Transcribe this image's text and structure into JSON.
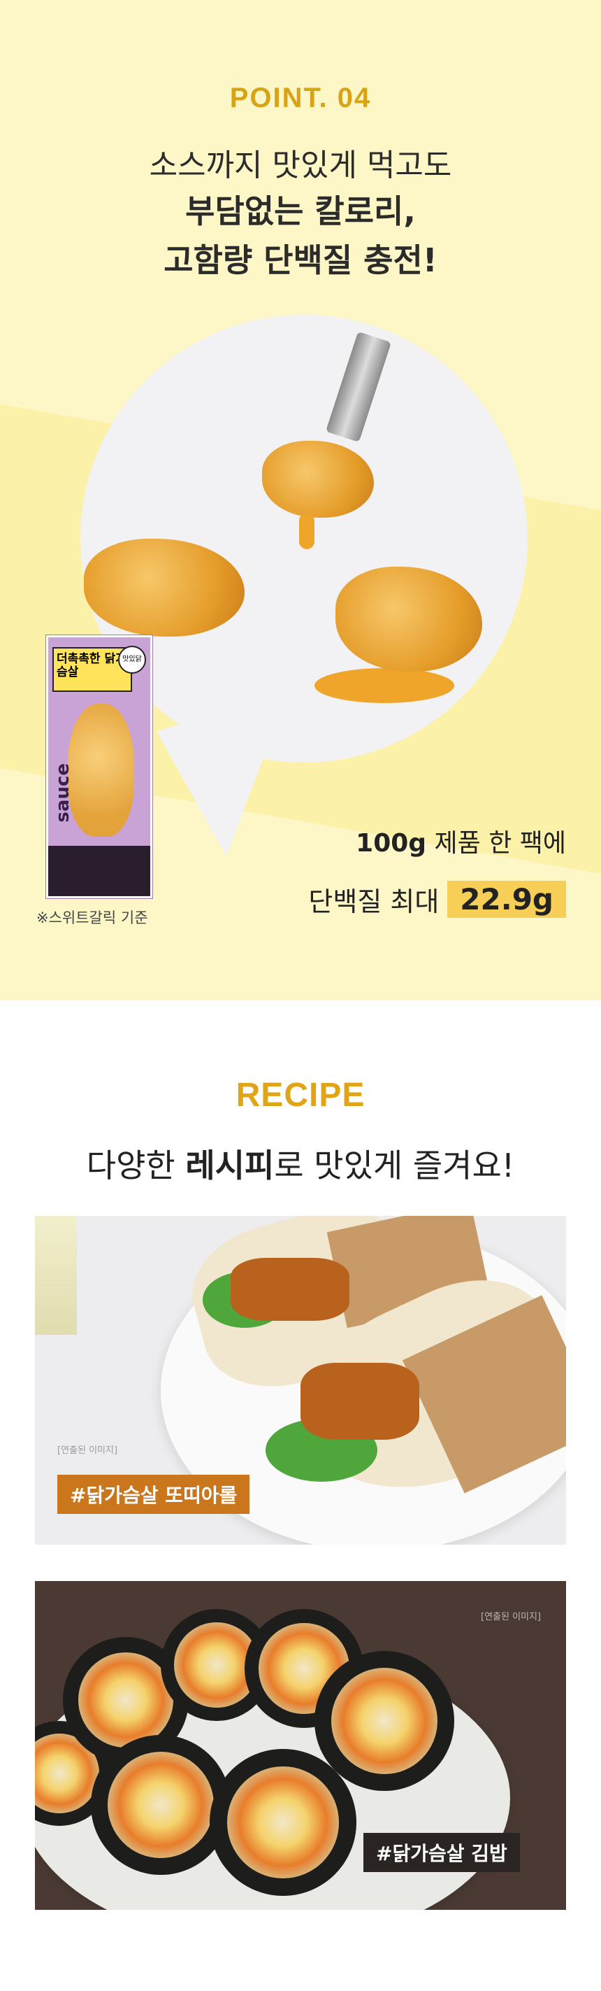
{
  "point": {
    "label": "POINT. 04",
    "line1": "소스까지 맛있게 먹고도",
    "line2": "부담없는 칼로리,",
    "line3": "고함량 단백질 충전!"
  },
  "product": {
    "pack_badge": "맛있닭",
    "pack_brand": "더촉촉한 닭가슴살",
    "pack_sauce": "sauce",
    "base_note": "※스위트갈릭 기준",
    "serving_prefix": "100g",
    "serving_suffix": " 제품 한 팩에",
    "protein_label": "단백질 최대",
    "protein_value": "22.9g"
  },
  "recipe": {
    "label": "RECIPE",
    "headline_pre": "다양한 ",
    "headline_bold": "레시피",
    "headline_post": "로 맛있게 즐겨요!",
    "items": [
      {
        "tag": "#닭가슴살 또띠아롤",
        "note": "[연출된 이미지]"
      },
      {
        "tag": "#닭가슴살 김밥",
        "note": "[연출된 이미지]"
      }
    ]
  },
  "colors": {
    "accent": "#e0a419",
    "highlight": "#f7cf57",
    "background": "#fdf7c8"
  }
}
